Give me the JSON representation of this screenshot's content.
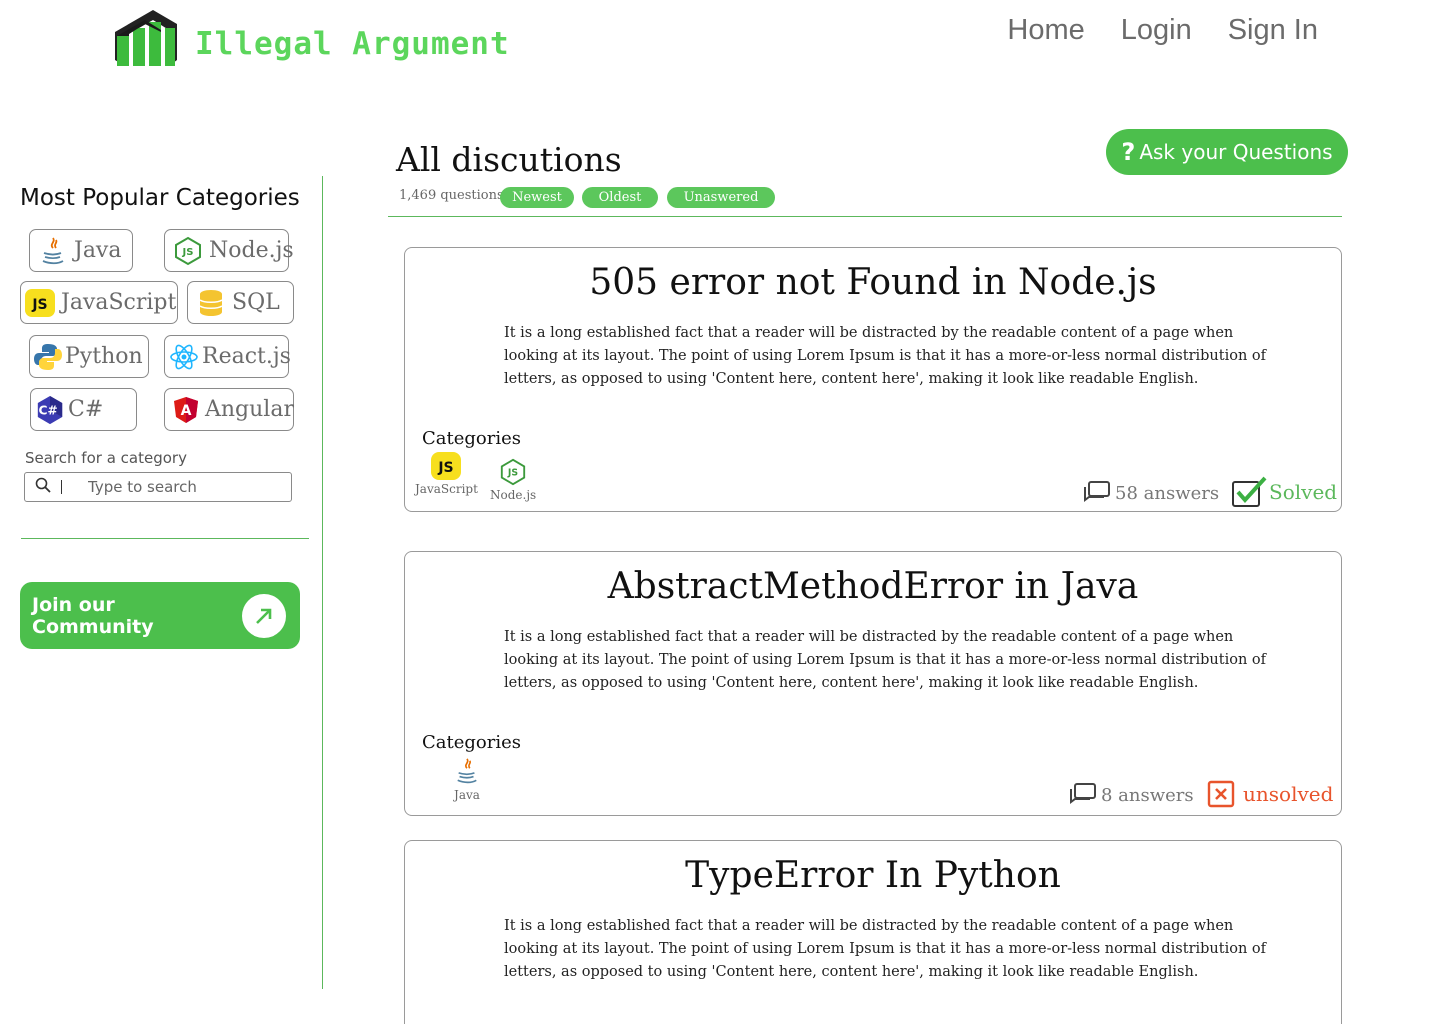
{
  "brand": {
    "name": "Illegal Argument",
    "color": "#5cd65c"
  },
  "nav": {
    "home": "Home",
    "login": "Login",
    "signin": "Sign In"
  },
  "sidebar": {
    "title": "Most Popular Categories",
    "categories": [
      {
        "label": "Java",
        "icon": "java-icon"
      },
      {
        "label": "Node.js",
        "icon": "nodejs-icon"
      },
      {
        "label": "JavaScript",
        "icon": "javascript-icon"
      },
      {
        "label": "SQL",
        "icon": "database-icon"
      },
      {
        "label": "Python",
        "icon": "python-icon"
      },
      {
        "label": "React.js",
        "icon": "react-icon"
      },
      {
        "label": "C#",
        "icon": "csharp-icon"
      },
      {
        "label": "Angular",
        "icon": "angular-icon"
      }
    ],
    "search_label": "Search for a category",
    "search_placeholder": "Type to search",
    "join_label": "Join our Community"
  },
  "main": {
    "title": "All discutions",
    "count": "1,469 questions",
    "filters": [
      "Newest",
      "Oldest",
      "Unaswered"
    ],
    "ask_label": "Ask your Questions",
    "ask_icon": "?"
  },
  "questions": [
    {
      "title": "505 error not Found in Node.js",
      "body": "It is a long established fact that a reader will be distracted by the readable content of a page when looking at its layout. The point of using Lorem Ipsum is that it has a more-or-less normal distribution of letters, as opposed to using 'Content here, content here', making it look like readable English.",
      "categories_label": "Categories",
      "categories": [
        "JavaScript",
        "Node.js"
      ],
      "answers": "58 answers",
      "status": "Solved",
      "status_color": "#5cb85c"
    },
    {
      "title": "AbstractMethodError in Java",
      "body": "It is a long established fact that a reader will be distracted by the readable content of a page when looking at its layout. The point of using Lorem Ipsum is that it has a more-or-less normal distribution of letters, as opposed to using 'Content here, content here', making it look like readable English.",
      "categories_label": "Categories",
      "categories": [
        "Java"
      ],
      "answers": "8 answers",
      "status": "unsolved",
      "status_color": "#e8542c"
    },
    {
      "title": "TypeError In Python",
      "body": "It is a long established fact that a reader will be distracted by the readable content of a page when looking at its layout. The point of using Lorem Ipsum is that it has a more-or-less normal distribution of letters, as opposed to using 'Content here, content here', making it look like readable English."
    }
  ],
  "accent_color": "#4cbf4c"
}
